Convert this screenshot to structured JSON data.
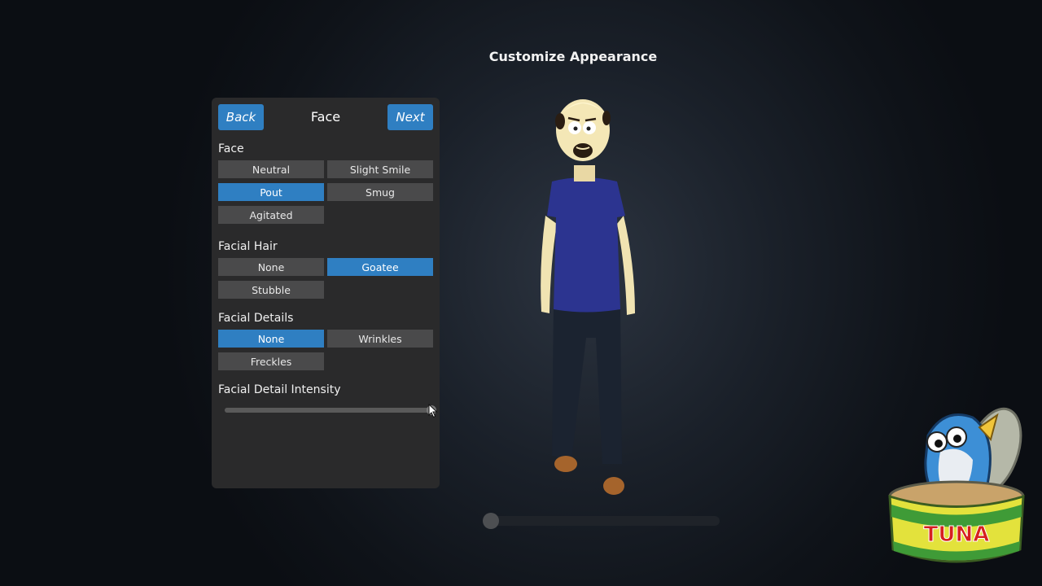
{
  "screen": {
    "title": "Customize Appearance"
  },
  "panel": {
    "back_label": "Back",
    "next_label": "Next",
    "title": "Face",
    "sections": {
      "face": {
        "label": "Face",
        "options": [
          "Neutral",
          "Slight Smile",
          "Pout",
          "Smug",
          "Agitated"
        ],
        "selected": "Pout"
      },
      "facial_hair": {
        "label": "Facial Hair",
        "options": [
          "None",
          "Goatee",
          "Stubble"
        ],
        "selected": "Goatee"
      },
      "facial_details": {
        "label": "Facial Details",
        "options": [
          "None",
          "Wrinkles",
          "Freckles"
        ],
        "selected": "None"
      },
      "intensity": {
        "label": "Facial Detail Intensity",
        "value": 1.0
      }
    }
  },
  "rotation_slider": {
    "value": 0.03
  },
  "logo": {
    "text": "TUNA"
  },
  "colors": {
    "accent": "#2f7fc2",
    "panel_bg": "#2a2a2b",
    "option_bg": "#4a4a4b"
  }
}
